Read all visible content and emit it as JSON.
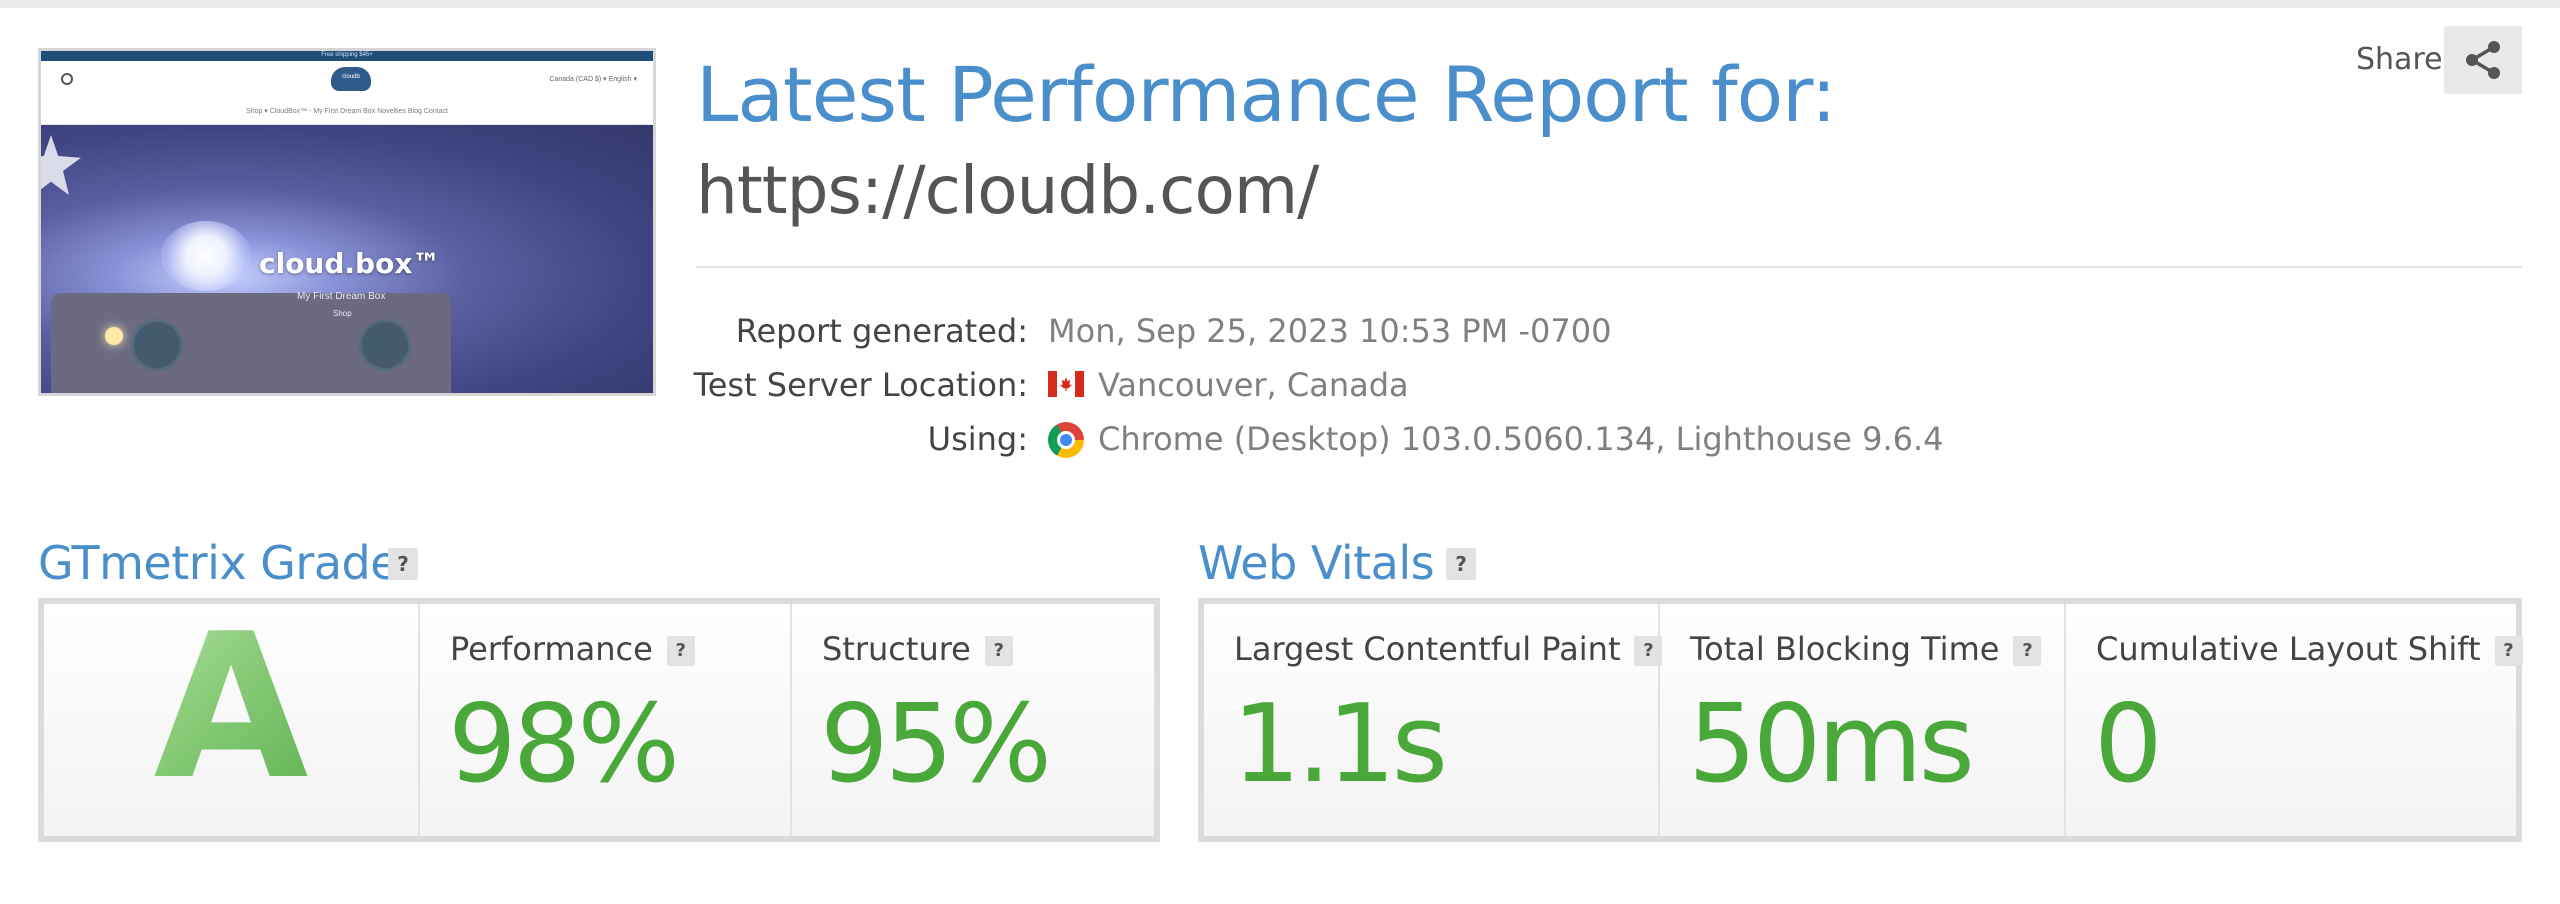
{
  "thumbnail": {
    "announcement": "Free shipping $45+",
    "logo_text": "cloudb",
    "top_right": "Canada (CAD $)  ▾   English  ▾",
    "menu": "Shop ▾     CloudBox™ - My First Dream Box     Novelties     Blog     Contact",
    "hero_title": "cloud.box™",
    "hero_subtitle": "My First Dream Box",
    "hero_button": "Shop"
  },
  "header": {
    "title": "Latest Performance Report for:",
    "url": "https://cloudb.com/"
  },
  "share": {
    "label": "Share",
    "icon": "share-icon"
  },
  "meta": {
    "generated_label": "Report generated:",
    "generated_value": "Mon, Sep 25, 2023 10:53 PM -0700",
    "location_label": "Test Server Location:",
    "location_value": "Vancouver, Canada",
    "location_icon": "canada-flag-icon",
    "using_label": "Using:",
    "using_value": "Chrome (Desktop) 103.0.5060.134, Lighthouse 9.6.4",
    "using_icon": "chrome-icon"
  },
  "grade": {
    "title": "GTmetrix Grade",
    "help": "?",
    "letter": "A",
    "performance_label": "Performance",
    "performance_value": "98%",
    "structure_label": "Structure",
    "structure_value": "95%"
  },
  "vitals": {
    "title": "Web Vitals",
    "help": "?",
    "lcp_label": "Largest Contentful Paint",
    "lcp_value": "1.1s",
    "tbt_label": "Total Blocking Time",
    "tbt_value": "50ms",
    "cls_label": "Cumulative Layout Shift",
    "cls_value": "0"
  },
  "colors": {
    "accent_blue": "#4a8fcc",
    "good_green": "#4aa83a",
    "panel_border": "#dcdcdc"
  }
}
